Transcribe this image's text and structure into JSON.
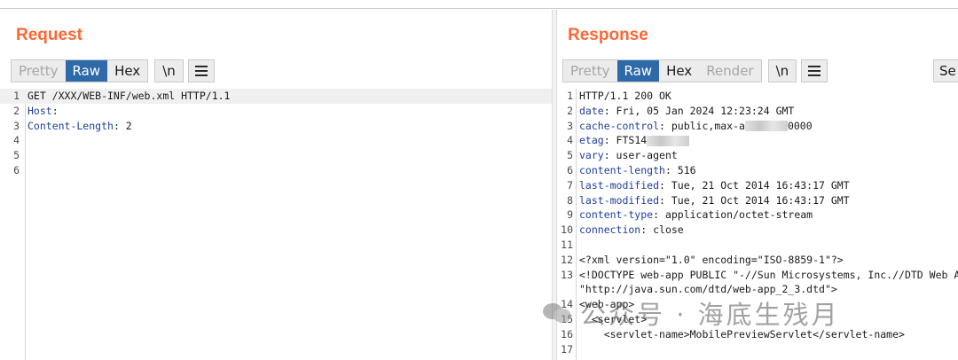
{
  "request": {
    "title": "Request",
    "view_buttons": [
      {
        "label": "Pretty",
        "state": "disabled"
      },
      {
        "label": "Raw",
        "state": "active"
      },
      {
        "label": "Hex",
        "state": "normal"
      }
    ],
    "newline_label": "\\n",
    "lines": [
      {
        "n": "1",
        "key": "",
        "rest": "GET /XXX/WEB-INF/web.xml HTTP/1.1"
      },
      {
        "n": "2",
        "key": "Host",
        "rest": ":"
      },
      {
        "n": "3",
        "key": "Content-Length",
        "rest": ": 2"
      },
      {
        "n": "4",
        "key": "",
        "rest": ""
      },
      {
        "n": "5",
        "key": "",
        "rest": ""
      },
      {
        "n": "6",
        "key": "",
        "rest": ""
      }
    ]
  },
  "response": {
    "title": "Response",
    "view_buttons": [
      {
        "label": "Pretty",
        "state": "disabled"
      },
      {
        "label": "Raw",
        "state": "active"
      },
      {
        "label": "Hex",
        "state": "normal"
      },
      {
        "label": "Render",
        "state": "disabled"
      }
    ],
    "newline_label": "\\n",
    "side_button_label": "Se",
    "lines": [
      {
        "n": "1",
        "key": "",
        "rest": "HTTP/1.1 200 OK"
      },
      {
        "n": "2",
        "key": "date",
        "rest": ": Fri, 05 Jan 2024 12:23:24 GMT"
      },
      {
        "n": "3",
        "key": "cache-control",
        "rest": ": public,max-a",
        "tail": "0000"
      },
      {
        "n": "4",
        "key": "etag",
        "rest": ": FTS14"
      },
      {
        "n": "5",
        "key": "vary",
        "rest": ": user-agent"
      },
      {
        "n": "6",
        "key": "content-length",
        "rest": ": 516"
      },
      {
        "n": "7",
        "key": "last-modified",
        "rest": ": Tue, 21 Oct 2014 16:43:17 GMT"
      },
      {
        "n": "8",
        "key": "last-modified",
        "rest": ": Tue, 21 Oct 2014 16:43:17 GMT"
      },
      {
        "n": "9",
        "key": "content-type",
        "rest": ": application/octet-stream"
      },
      {
        "n": "10",
        "key": "connection",
        "rest": ": close"
      },
      {
        "n": "11",
        "key": "",
        "rest": ""
      },
      {
        "n": "12",
        "key": "",
        "rest": "<?xml version=\"1.0\" encoding=\"ISO-8859-1\"?>"
      },
      {
        "n": "13",
        "key": "",
        "rest": "<!DOCTYPE web-app PUBLIC \"-//Sun Microsystems, Inc.//DTD Web App"
      },
      {
        "n": "",
        "key": "",
        "rest": "\"http://java.sun.com/dtd/web-app_2_3.dtd\">"
      },
      {
        "n": "14",
        "key": "",
        "rest": "<web-app>"
      },
      {
        "n": "15",
        "key": "",
        "rest": "  <servlet>"
      },
      {
        "n": "16",
        "key": "",
        "rest": "    <servlet-name>MobilePreviewServlet</servlet-name>"
      },
      {
        "n": "17",
        "key": "",
        "rest": ""
      }
    ]
  },
  "watermark": {
    "text": "公众号 · 海底生残月"
  },
  "colors": {
    "title": "#ff6633",
    "active_button": "#2f6aa8",
    "header_key": "#1e3e9c"
  }
}
